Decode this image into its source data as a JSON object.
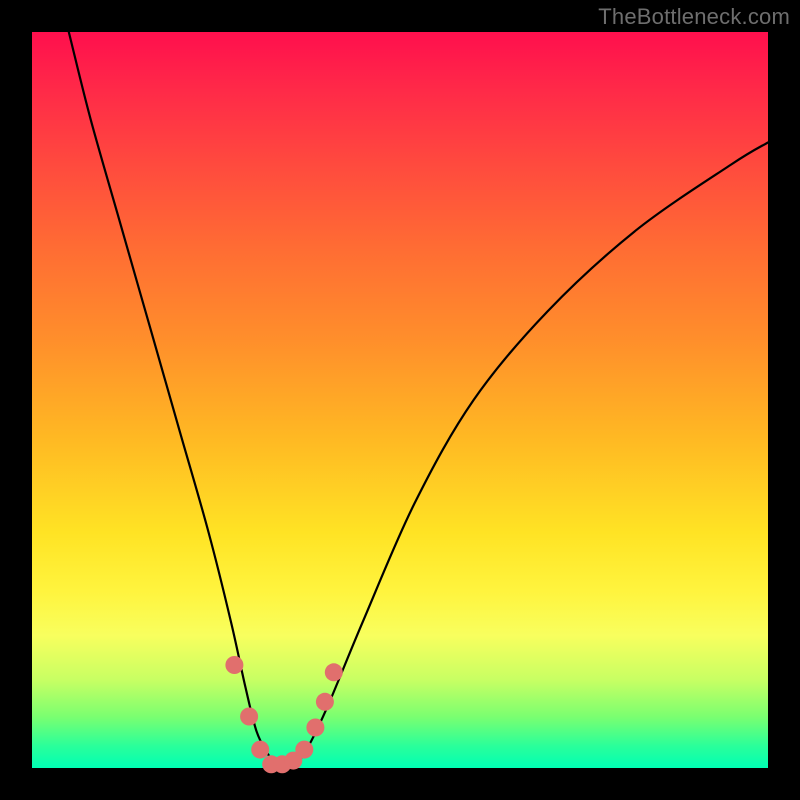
{
  "watermark": "TheBottleneck.com",
  "chart_data": {
    "type": "line",
    "title": "",
    "xlabel": "",
    "ylabel": "",
    "xlim": [
      0,
      100
    ],
    "ylim": [
      0,
      100
    ],
    "series": [
      {
        "name": "bottleneck-curve",
        "x": [
          3,
          5,
          8,
          12,
          16,
          20,
          24,
          27,
          29,
          30.5,
          32,
          33.5,
          35,
          37,
          40,
          45,
          52,
          60,
          70,
          82,
          95,
          100
        ],
        "values": [
          108,
          100,
          88,
          74,
          60,
          46,
          32,
          20,
          11,
          5,
          2,
          0,
          0,
          2,
          8,
          20,
          36,
          50,
          62,
          73,
          82,
          85
        ]
      }
    ],
    "markers": {
      "name": "highlight-dots",
      "points": [
        {
          "x": 27.5,
          "y": 14
        },
        {
          "x": 29.5,
          "y": 7
        },
        {
          "x": 31.0,
          "y": 2.5
        },
        {
          "x": 32.5,
          "y": 0.5
        },
        {
          "x": 34.0,
          "y": 0.5
        },
        {
          "x": 35.5,
          "y": 1.0
        },
        {
          "x": 37.0,
          "y": 2.5
        },
        {
          "x": 38.5,
          "y": 5.5
        },
        {
          "x": 39.8,
          "y": 9
        },
        {
          "x": 41.0,
          "y": 13
        }
      ]
    },
    "colors": {
      "curve": "#000000",
      "markers": "#e16f6d",
      "gradient_top": "#ff0f4d",
      "gradient_bottom": "#00ffb4"
    }
  }
}
